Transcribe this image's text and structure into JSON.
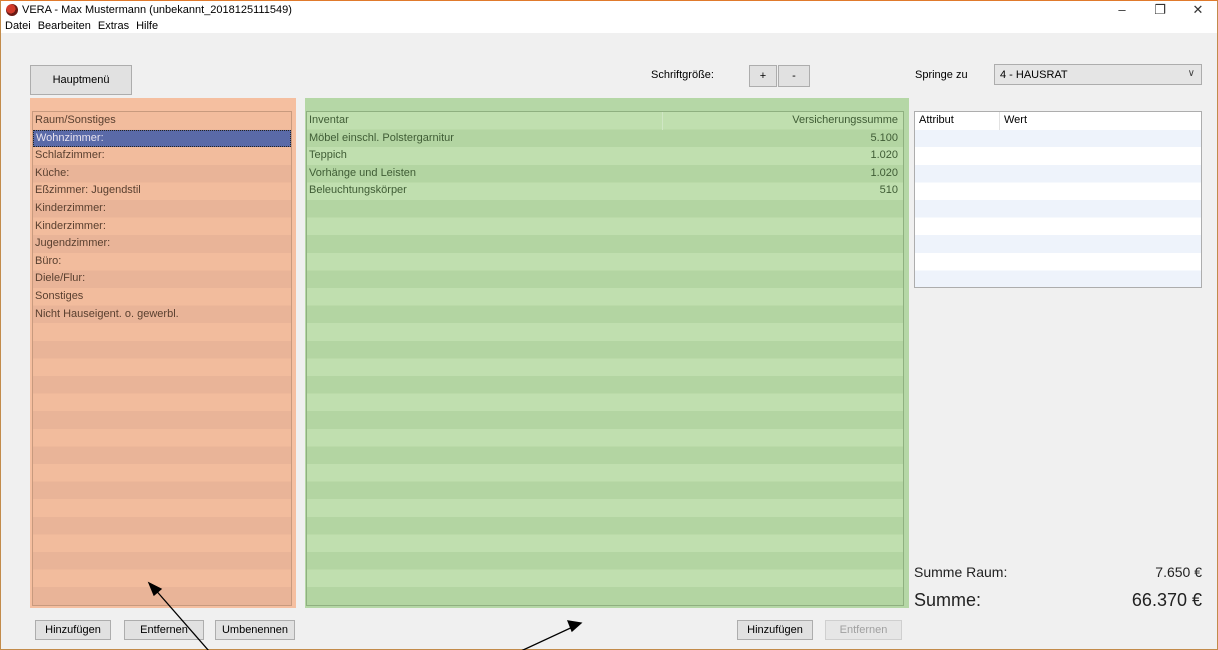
{
  "window": {
    "title": "VERA - Max Mustermann (unbekannt_2018125111549)",
    "controls": {
      "minimize": "–",
      "maximize": "❐",
      "close": "✕"
    }
  },
  "menu": [
    "Datei",
    "Bearbeiten",
    "Extras",
    "Hilfe"
  ],
  "toolbar": {
    "main_menu_label": "Hauptmenü",
    "font_size_label": "Schriftgröße:",
    "font_plus": "+",
    "font_minus": "-",
    "jump_label": "Springe zu",
    "jump_value": "4 - HAUSRAT"
  },
  "rooms": {
    "header": "Raum/Sonstiges",
    "items": [
      "Wohnzimmer:",
      "Schlafzimmer:",
      "Küche:",
      "Eßzimmer: Jugendstil",
      "Kinderzimmer:",
      "Kinderzimmer:",
      "Jugendzimmer:",
      "Büro:",
      "Diele/Flur:",
      "Sonstiges",
      "Nicht Hauseigent. o. gewerbl."
    ],
    "selected_index": 0,
    "buttons": {
      "add": "Hinzufügen",
      "remove": "Entfernen",
      "rename": "Umbenennen"
    }
  },
  "inventory": {
    "header_item": "Inventar",
    "header_sum": "Versicherungssumme",
    "rows": [
      {
        "item": "Möbel einschl. Polstergarnitur",
        "sum": "5.100"
      },
      {
        "item": "Teppich",
        "sum": "1.020"
      },
      {
        "item": "Vorhänge und Leisten",
        "sum": "1.020"
      },
      {
        "item": "Beleuchtungskörper",
        "sum": "510"
      }
    ],
    "buttons": {
      "add": "Hinzufügen",
      "remove": "Entfernen"
    }
  },
  "attributes": {
    "header_attr": "Attribut",
    "header_value": "Wert"
  },
  "totals": {
    "room_label": "Summe Raum:",
    "room_value": "7.650 €",
    "total_label": "Summe:",
    "total_value": "66.370 €"
  }
}
